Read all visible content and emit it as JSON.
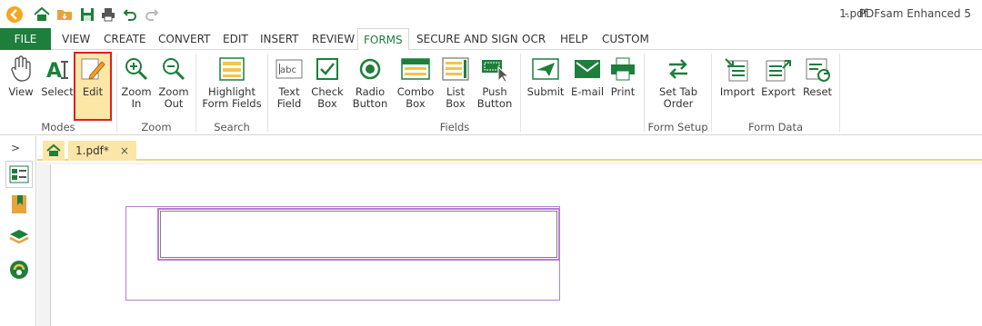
{
  "window": {
    "file_name": "1.pdf",
    "app_title": "-   PDFsam Enhanced 5"
  },
  "quick_access": [
    "app-logo-icon",
    "home-icon",
    "open-folder-icon",
    "save-icon",
    "print-icon",
    "undo-icon",
    "redo-icon"
  ],
  "menu": {
    "file": "FILE",
    "tabs": [
      "VIEW",
      "CREATE",
      "CONVERT",
      "EDIT",
      "INSERT",
      "REVIEW",
      "FORMS",
      "SECURE AND SIGN",
      "OCR",
      "HELP",
      "CUSTOM"
    ],
    "active": "FORMS"
  },
  "ribbon": {
    "buttons": {
      "view": "View",
      "select": "Select",
      "edit": "Edit",
      "zoom_in": "Zoom\nIn",
      "zoom_out": "Zoom\nOut",
      "highlight": "Highlight\nForm Fields",
      "text_field": "Text\nField",
      "check_box": "Check\nBox",
      "radio_button": "Radio\nButton",
      "combo_box": "Combo\nBox",
      "list_box": "List\nBox",
      "push_button": "Push\nButton",
      "submit": "Submit",
      "email": "E-mail",
      "print": "Print",
      "set_tab_order": "Set Tab\nOrder",
      "import": "Import",
      "export": "Export",
      "reset": "Reset"
    },
    "groups": {
      "modes": "Modes",
      "zoom": "Zoom",
      "search": "Search",
      "fields": "Fields",
      "form_setup": "Form Setup",
      "form_data": "Form Data"
    },
    "selected_button": "Edit"
  },
  "document_tabs": {
    "active_tab": "1.pdf*",
    "close_glyph": "×"
  },
  "sidebar": {
    "expand_glyph": ">",
    "items": [
      "page-thumbnails-icon",
      "bookmarks-icon",
      "layers-icon",
      "attachments-icon"
    ]
  },
  "colors": {
    "accent": "#1e7e3c",
    "selected_fill": "#fde7a6",
    "selected_border": "#e02020",
    "field_border": "#b57fd0"
  }
}
